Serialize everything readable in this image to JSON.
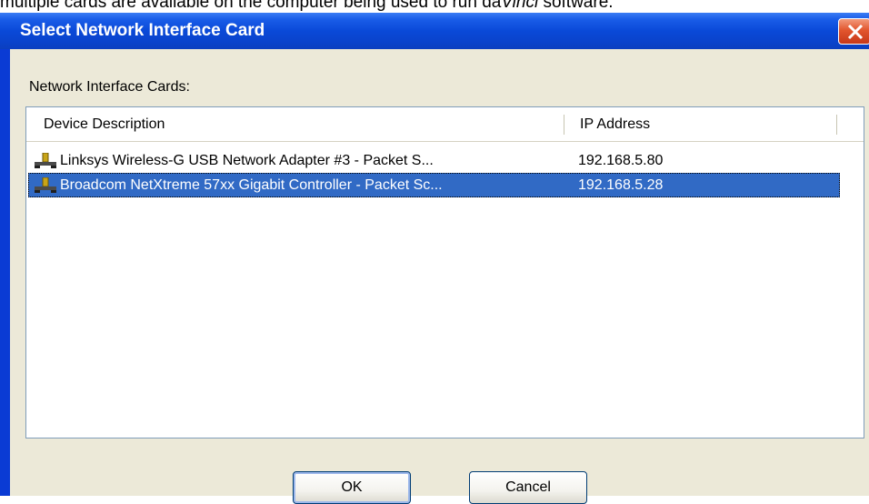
{
  "caption": {
    "prefix": "multiple cards are available on the computer being used to run da",
    "italic": "Vinci",
    "suffix": " software."
  },
  "dialog": {
    "title": "Select Network Interface Card",
    "close_icon": "close-x-icon",
    "section_label": "Network Interface Cards:",
    "columns": [
      "Device Description",
      "IP Address"
    ],
    "rows": [
      {
        "icon": "network-adapter-icon",
        "description": "Linksys Wireless-G USB Network Adapter #3 - Packet S...",
        "ip": "192.168.5.80",
        "selected": false
      },
      {
        "icon": "network-adapter-icon",
        "description": "Broadcom NetXtreme 57xx Gigabit Controller - Packet Sc...",
        "ip": "192.168.5.28",
        "selected": true
      }
    ],
    "buttons": {
      "ok": "OK",
      "cancel": "Cancel"
    }
  },
  "colors": {
    "titlebar": "#0a49d8",
    "selection": "#316ac5",
    "close_button": "#e2562e",
    "dialog_face": "#ece9d8"
  }
}
